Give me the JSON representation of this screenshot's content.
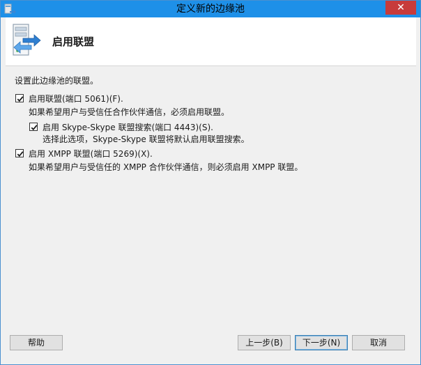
{
  "window": {
    "title": "定义新的边缘池",
    "close_label": "✕"
  },
  "header": {
    "title": "启用联盟",
    "icon": "server-arrow-icon"
  },
  "content": {
    "intro": "设置此边缘池的联盟。",
    "federation": {
      "checked": true,
      "label": "启用联盟(端口 5061)(F).",
      "description": "如果希望用户与受信任合作伙伴通信，必须启用联盟。"
    },
    "skype_search": {
      "checked": true,
      "label": "启用 Skype-Skype 联盟搜索(端口 4443)(S).",
      "description": "选择此选项，Skype-Skype 联盟将默认启用联盟搜索。"
    },
    "xmpp": {
      "checked": true,
      "label": "启用 XMPP 联盟(端口 5269)(X).",
      "description": "如果希望用户与受信任的 XMPP 合作伙伴通信，则必须启用 XMPP 联盟。"
    }
  },
  "buttons": {
    "help": "帮助",
    "back": "上一步(B)",
    "next": "下一步(N)",
    "cancel": "取消"
  },
  "colors": {
    "titlebar": "#1e90e8",
    "close": "#c73b3b",
    "panel": "#f0f0f0"
  }
}
